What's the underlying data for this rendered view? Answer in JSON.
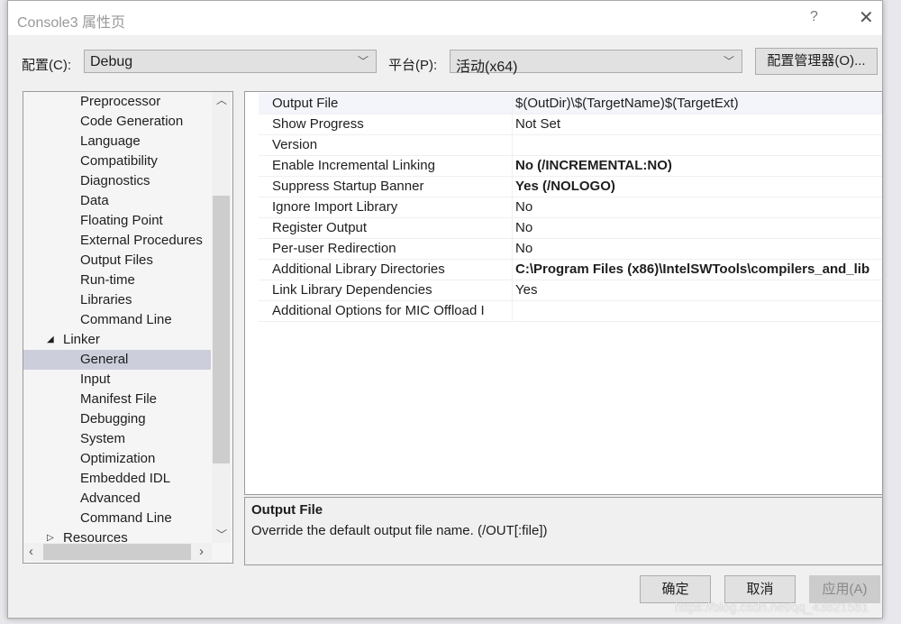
{
  "window": {
    "title": "Console3 属性页",
    "help": "?",
    "close": "✕"
  },
  "config": {
    "label": "配置(C):",
    "value": "Debug",
    "platform_label": "平台(P):",
    "platform_value": "活动(x64)",
    "manager_button": "配置管理器(O)..."
  },
  "tree": {
    "items": [
      {
        "label": "Preprocessor",
        "level": 2
      },
      {
        "label": "Code Generation",
        "level": 2
      },
      {
        "label": "Language",
        "level": 2
      },
      {
        "label": "Compatibility",
        "level": 2
      },
      {
        "label": "Diagnostics",
        "level": 2
      },
      {
        "label": "Data",
        "level": 2
      },
      {
        "label": "Floating Point",
        "level": 2
      },
      {
        "label": "External Procedures",
        "level": 2
      },
      {
        "label": "Output Files",
        "level": 2
      },
      {
        "label": "Run-time",
        "level": 2
      },
      {
        "label": "Libraries",
        "level": 2
      },
      {
        "label": "Command Line",
        "level": 2
      },
      {
        "label": "Linker",
        "level": 1,
        "expander": "◢"
      },
      {
        "label": "General",
        "level": 2,
        "selected": true
      },
      {
        "label": "Input",
        "level": 2
      },
      {
        "label": "Manifest File",
        "level": 2
      },
      {
        "label": "Debugging",
        "level": 2
      },
      {
        "label": "System",
        "level": 2
      },
      {
        "label": "Optimization",
        "level": 2
      },
      {
        "label": "Embedded IDL",
        "level": 2
      },
      {
        "label": "Advanced",
        "level": 2
      },
      {
        "label": "Command Line",
        "level": 2
      },
      {
        "label": "Resources",
        "level": 1,
        "expander": "▷"
      }
    ]
  },
  "properties": [
    {
      "name": "Output File",
      "value": "$(OutDir)\\$(TargetName)$(TargetExt)",
      "bold": false
    },
    {
      "name": "Show Progress",
      "value": "Not Set",
      "bold": false
    },
    {
      "name": "Version",
      "value": "",
      "bold": false
    },
    {
      "name": "Enable Incremental Linking",
      "value": "No (/INCREMENTAL:NO)",
      "bold": true
    },
    {
      "name": "Suppress Startup Banner",
      "value": "Yes (/NOLOGO)",
      "bold": true
    },
    {
      "name": "Ignore Import Library",
      "value": "No",
      "bold": false
    },
    {
      "name": "Register Output",
      "value": "No",
      "bold": false
    },
    {
      "name": "Per-user Redirection",
      "value": "No",
      "bold": false
    },
    {
      "name": "Additional Library Directories",
      "value": "C:\\Program Files (x86)\\IntelSWTools\\compilers_and_lib",
      "bold": true
    },
    {
      "name": "Link Library Dependencies",
      "value": "Yes",
      "bold": false
    },
    {
      "name": "Additional Options for MIC Offload I",
      "value": "",
      "bold": false
    }
  ],
  "description": {
    "title": "Output File",
    "text": "Override the default output file name. (/OUT[:file])"
  },
  "buttons": {
    "ok": "确定",
    "cancel": "取消",
    "apply": "应用(A)"
  },
  "watermark": "https://blog.csdn.net/qq_43621561"
}
